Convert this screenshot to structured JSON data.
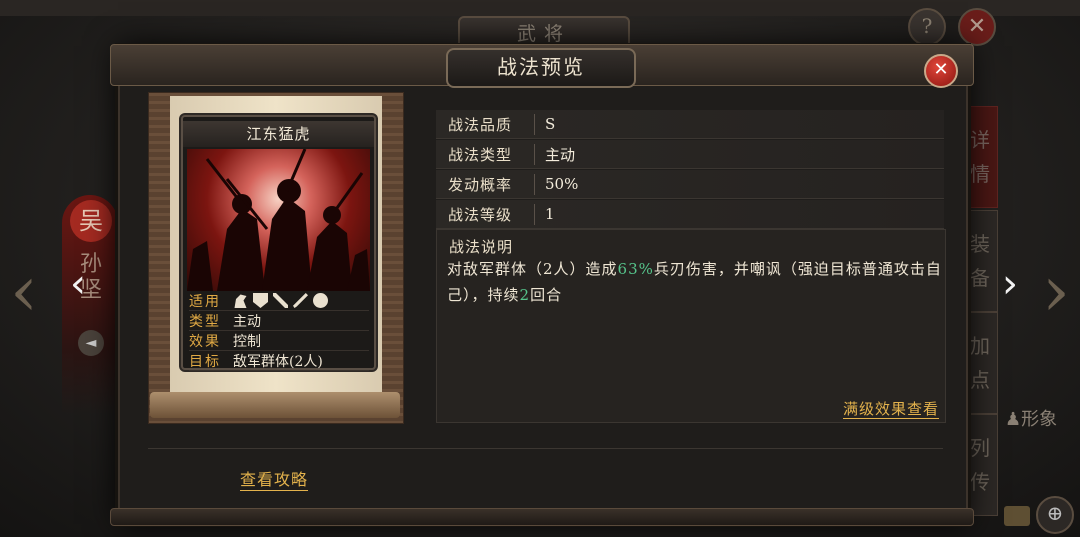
{
  "background": {
    "window_title": "武将",
    "help_glyph": "?",
    "close_glyph": "✕",
    "faction_char": "吴",
    "general_name": "孙坚",
    "side_tabs": [
      "详情",
      "装备",
      "加点",
      "列传"
    ],
    "appearance_label": "形象"
  },
  "modal": {
    "title": "战法预览",
    "close_glyph": "✕"
  },
  "card": {
    "name": "江东猛虎",
    "stats": [
      {
        "key": "适用",
        "icons": [
          "horse-icon",
          "shield-icon",
          "bow-icon",
          "spear-icon",
          "wheel-icon"
        ]
      },
      {
        "key": "类型",
        "value": "主动"
      },
      {
        "key": "效果",
        "value": "控制"
      },
      {
        "key": "目标",
        "value": "敌军群体(2人)"
      }
    ]
  },
  "info": {
    "rows": [
      {
        "label": "战法品质",
        "value": "S"
      },
      {
        "label": "战法类型",
        "value": "主动"
      },
      {
        "label": "发动概率",
        "value": "50%"
      },
      {
        "label": "战法等级",
        "value": "1"
      }
    ],
    "description": {
      "title": "战法说明",
      "part1": "对敌军群体（2人）造成",
      "highlight1": "63%",
      "part2": "兵刃伤害，并嘲讽（强迫目标普通攻击自己），持续",
      "highlight2": "2",
      "part3": "回合"
    },
    "full_effect_link": "满级效果查看"
  },
  "guide_link": "查看攻略",
  "colors": {
    "accent_gold": "#e3b24c",
    "highlight_green": "#56c48b",
    "close_red": "#c9231a"
  }
}
